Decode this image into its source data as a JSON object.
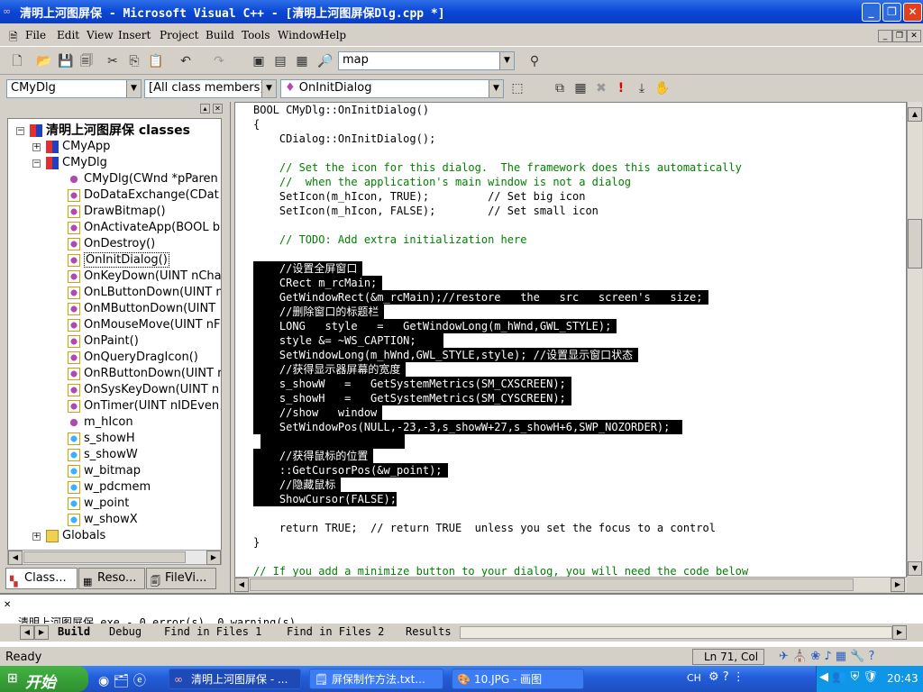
{
  "window": {
    "title": "清明上河图屏保 - Microsoft Visual C++ - [清明上河图屏保Dlg.cpp *]"
  },
  "menu": [
    "File",
    "Edit",
    "View",
    "Insert",
    "Project",
    "Build",
    "Tools",
    "Window",
    "Help"
  ],
  "toolbar": {
    "find_value": "map"
  },
  "wizardbar": {
    "class": "CMyDlg",
    "filter": "[All class members]",
    "member": "OnInitDialog"
  },
  "tree": {
    "root": "清明上河图屏保 classes",
    "items": [
      "CMyApp",
      "CMyDlg",
      "CMyDlg(CWnd *pParen",
      "DoDataExchange(CDat",
      "DrawBitmap()",
      "OnActivateApp(BOOL b",
      "OnDestroy()",
      "OnInitDialog()",
      "OnKeyDown(UINT nCha",
      "OnLButtonDown(UINT n",
      "OnMButtonDown(UINT",
      "OnMouseMove(UINT nF",
      "OnPaint()",
      "OnQueryDragIcon()",
      "OnRButtonDown(UINT n",
      "OnSysKeyDown(UINT n",
      "OnTimer(UINT nIDEven",
      "m_hIcon",
      "s_showH",
      "s_showW",
      "w_bitmap",
      "w_pdcmem",
      "w_point",
      "w_showX",
      "Globals"
    ]
  },
  "pane_tabs": [
    "Class...",
    "Reso...",
    "FileVi..."
  ],
  "code": [
    "BOOL CMyDlg::OnInitDialog()",
    "{",
    "    CDialog::OnInitDialog();",
    "",
    "    // Set the icon for this dialog.  The framework does this automatically",
    "    //  when the application's main window is not a dialog",
    "    SetIcon(m_hIcon, TRUE);         // Set big icon",
    "    SetIcon(m_hIcon, FALSE);        // Set small icon",
    "",
    "    // TODO: Add extra initialization here",
    "",
    "    //设置全屏窗口",
    "    CRect m_rcMain;",
    "    GetWindowRect(&m_rcMain);//restore   the   src   screen's   size;",
    "    //删除窗口的标题栏",
    "    LONG   style   =   GetWindowLong(m_hWnd,GWL_STYLE);",
    "    style &= ~WS_CAPTION;",
    "    SetWindowLong(m_hWnd,GWL_STYLE,style); //设置显示窗口状态",
    "    //获得显示器屏幕的宽度",
    "    s_showW   =   GetSystemMetrics(SM_CXSCREEN);",
    "    s_showH   =   GetSystemMetrics(SM_CYSCREEN);",
    "    //show   window",
    "    SetWindowPos(NULL,-23,-3,s_showW+27,s_showH+6,SWP_NOZORDER);",
    "",
    "    //获得鼠标的位置",
    "    ::GetCursorPos(&w_point);",
    "    //隐藏鼠标",
    "    ShowCursor(FALSE);",
    "",
    "    return TRUE;  // return TRUE  unless you set the focus to a control",
    "}",
    "",
    "// If you add a minimize button to your dialog, you will need the code below"
  ],
  "output": {
    "text": "清明上河图屏保.exe - 0 error(s), 0 warning(s)",
    "tabs": [
      "Build",
      "Debug",
      "Find in Files 1",
      "Find in Files 2",
      "Results"
    ]
  },
  "status": {
    "left": "Ready",
    "position": "Ln 71, Col"
  },
  "taskbar": {
    "start": "开始",
    "tasks": [
      "清明上河图屏保 - ...",
      "屏保制作方法.txt...",
      "10.JPG - 画图"
    ],
    "lang": "CH",
    "clock": "20:43"
  }
}
